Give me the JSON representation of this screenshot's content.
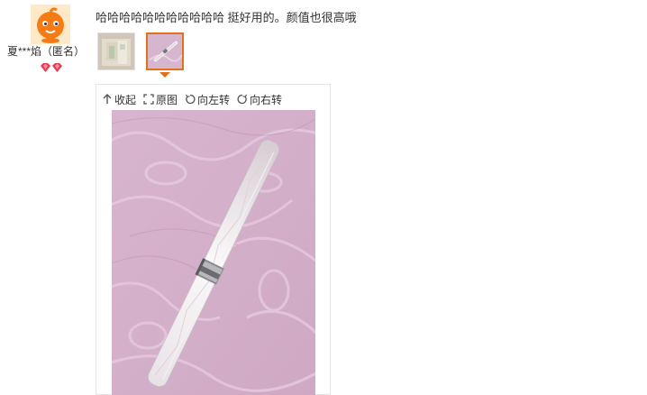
{
  "review": {
    "username": "夏***焰（匿名）",
    "text": "哈哈哈哈哈哈哈哈哈哈哈 挺好用的。颜值也很高哦",
    "avatar_icon": "taobao-baby-avatar-icon",
    "level_icon": "vip-diamond-icon"
  },
  "thumbnails": [
    {
      "icon": "product-photo-1",
      "selected": false
    },
    {
      "icon": "product-photo-2",
      "selected": true
    }
  ],
  "viewer": {
    "collapse_label": "收起",
    "original_label": "原图",
    "rotate_left_label": "向左转",
    "rotate_right_label": "向右转"
  },
  "colors": {
    "accent": "#e4701b",
    "photo_bg": "#d9b8d2"
  }
}
